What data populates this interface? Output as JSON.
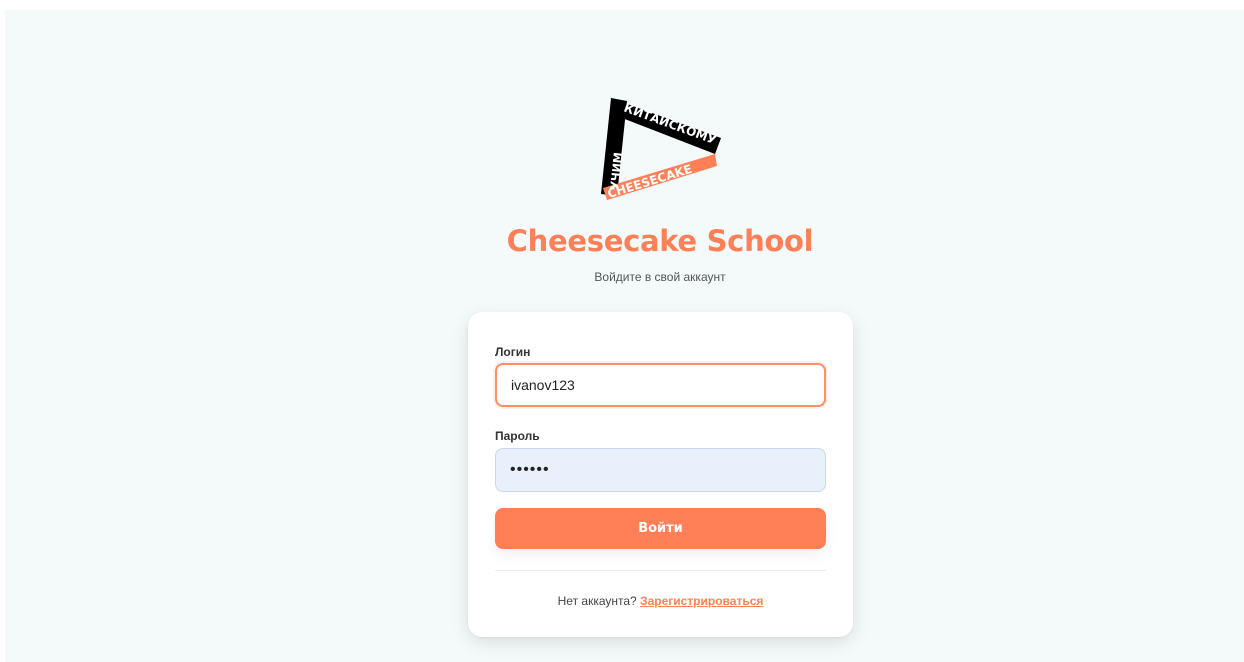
{
  "brand": {
    "logo_text_top": "КИТАЙСКОМУ",
    "logo_text_left": "УЧИМ",
    "logo_text_bottom": "CHEESECAKE",
    "title": "Cheesecake School",
    "subtitle": "Войдите в свой аккаунт"
  },
  "form": {
    "login_label": "Логин",
    "login_value": "ivanov123",
    "password_label": "Пароль",
    "password_value": "••••••",
    "submit_label": "Войти"
  },
  "footer": {
    "prompt": "Нет аккаунта?",
    "register_link": "Зарегистрироваться"
  },
  "colors": {
    "accent": "#ff7f56",
    "background": "#f4f9f9",
    "input_autofill": "#e8f0fb"
  }
}
